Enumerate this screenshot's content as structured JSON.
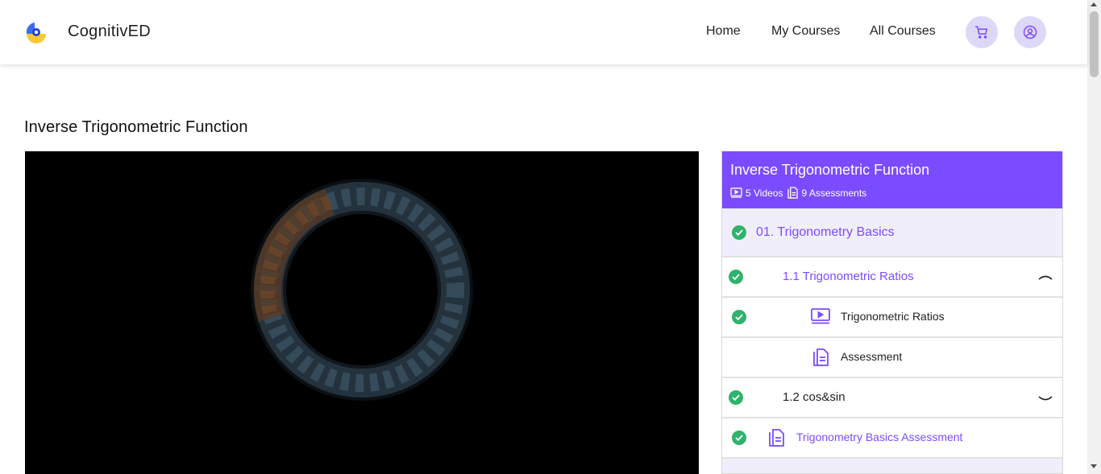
{
  "header": {
    "brand": "CognitivED",
    "nav": {
      "home": "Home",
      "my_courses": "My Courses",
      "all_courses": "All Courses"
    },
    "icons": {
      "cart": "cart-icon",
      "account": "user-circle-icon"
    }
  },
  "page": {
    "title": "Inverse Trigonometric Function"
  },
  "video": {
    "state": "loading-spinner"
  },
  "course_panel": {
    "title": "Inverse Trigonometric Function",
    "videos_label": "5 Videos",
    "assessments_label": "9 Assessments",
    "items": [
      {
        "label": "01. Trigonometry Basics",
        "completed": true,
        "level": "section"
      },
      {
        "label": "1.1 Trigonometric Ratios",
        "completed": true,
        "level": "subsection",
        "expanded": true
      },
      {
        "label": "Trigonometric Ratios",
        "completed": true,
        "level": "lesson",
        "kind": "video"
      },
      {
        "label": "Assessment",
        "completed": false,
        "level": "lesson",
        "kind": "assessment"
      },
      {
        "label": "1.2 cos&sin",
        "completed": true,
        "level": "subsection",
        "expanded": false
      },
      {
        "label": "Trigonometry Basics Assessment",
        "completed": true,
        "level": "assessment",
        "kind": "assessment"
      }
    ]
  },
  "colors": {
    "accent": "#7b4cff",
    "success": "#2fb36d",
    "icon_bg": "#ddd8f7"
  }
}
